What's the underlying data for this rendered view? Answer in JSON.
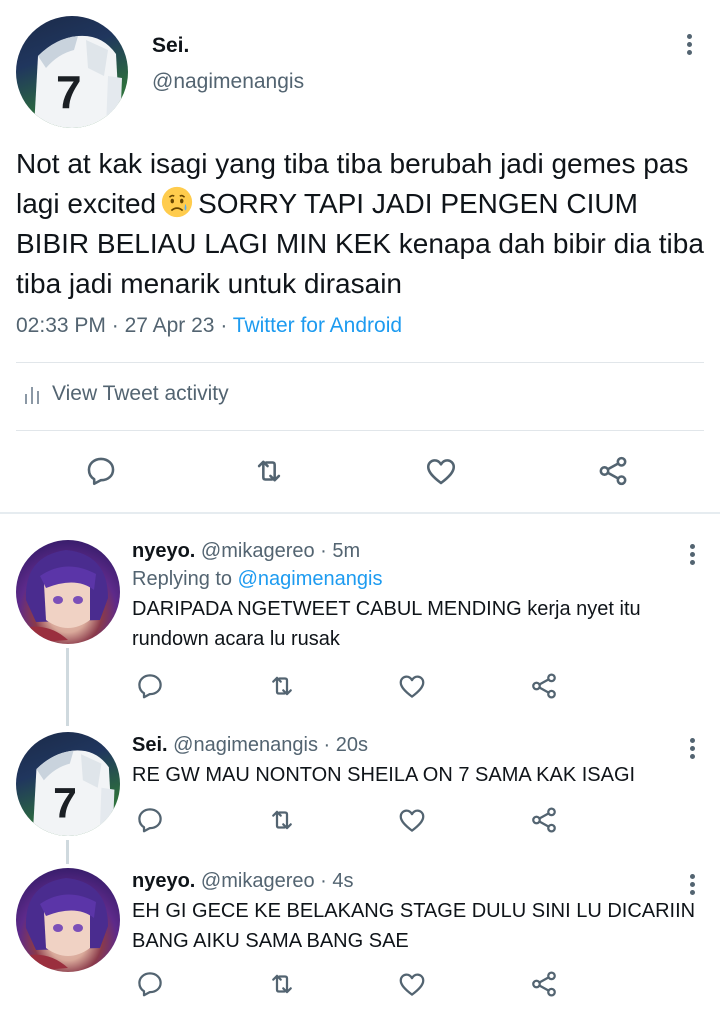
{
  "main_tweet": {
    "author_name": "Sei.",
    "author_handle": "@nagimenangis",
    "text_before_emoji": "Not at kak isagi yang tiba tiba berubah jadi gemes pas lagi excited",
    "emoji": "worried-face-emoji",
    "text_after_emoji": "SORRY TAPI JADI PENGEN CIUM BIBIR BELIAU LAGI MIN KEK kenapa dah bibir dia tiba tiba jadi menarik untuk dirasain",
    "time": "02:33 PM",
    "date": "27 Apr 23",
    "separator": "·",
    "source": "Twitter for Android",
    "activity_label": "View Tweet activity"
  },
  "replies": [
    {
      "name": "nyeyo.",
      "handle": "@mikagereo",
      "time": "· 5m",
      "replying_label": "Replying to",
      "replying_to": "@nagimenangis",
      "text": "DARIPADA NGETWEET CABUL MENDING kerja nyet itu rundown acara lu rusak"
    },
    {
      "name": "Sei.",
      "handle": "@nagimenangis",
      "time": "· 20s",
      "text": "RE GW MAU NONTON SHEILA ON 7 SAMA KAK ISAGI"
    },
    {
      "name": "nyeyo.",
      "handle": "@mikagereo",
      "time": "· 4s",
      "text": "EH GI GECE KE BELAKANG STAGE DULU SINI LU DICARIIN BANG AIKU SAMA BANG SAE"
    }
  ],
  "icons": {
    "reply": "comment-icon",
    "retweet": "retweet-icon",
    "like": "heart-icon",
    "share": "share-icon",
    "more": "more-vertical-icon",
    "activity": "bar-chart-icon"
  },
  "colors": {
    "text": "#0f1419",
    "secondary": "#536471",
    "link": "#1d9bf0",
    "divider": "#e1e6ea"
  }
}
